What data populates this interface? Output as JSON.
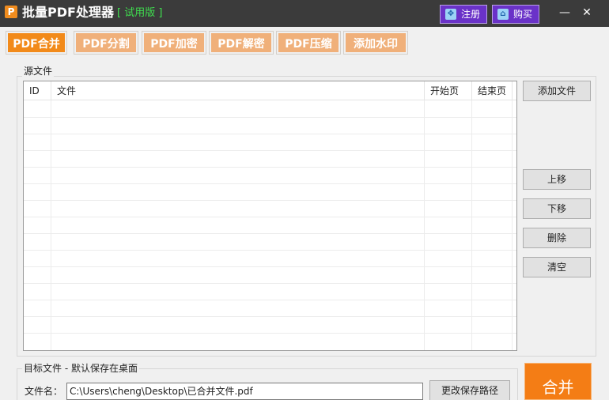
{
  "app": {
    "icon_letter": "P",
    "title": "批量PDF处理器",
    "trial_tag": "[ 试用版 ]",
    "register_label": "注册",
    "buy_label": "购买",
    "minimize": "—",
    "close": "✕"
  },
  "tabs": [
    {
      "label": "PDF合并",
      "active": true
    },
    {
      "label": "PDF分割",
      "active": false
    },
    {
      "label": "PDF加密",
      "active": false
    },
    {
      "label": "PDF解密",
      "active": false
    },
    {
      "label": "PDF压缩",
      "active": false
    },
    {
      "label": "添加水印",
      "active": false
    }
  ],
  "source": {
    "group_label": "源文件",
    "columns": [
      "ID",
      "文件",
      "开始页",
      "结束页"
    ],
    "buttons": {
      "add": "添加文件",
      "up": "上移",
      "down": "下移",
      "delete": "删除",
      "clear": "清空"
    }
  },
  "target": {
    "group_label": "目标文件 - 默认保存在桌面",
    "filename_label": "文件名：",
    "filename_value": "C:\\Users\\cheng\\Desktop\\已合并文件.pdf",
    "change_path_label": "更改保存路径"
  },
  "merge_button": "合并",
  "colors": {
    "titlebar": "#3b3b3b",
    "tab_active": "#f28a1a",
    "tab_inactive": "#f0b07a",
    "merge": "#f47d15",
    "trial": "#3fe04f",
    "purple_button": "#6a32c8"
  }
}
